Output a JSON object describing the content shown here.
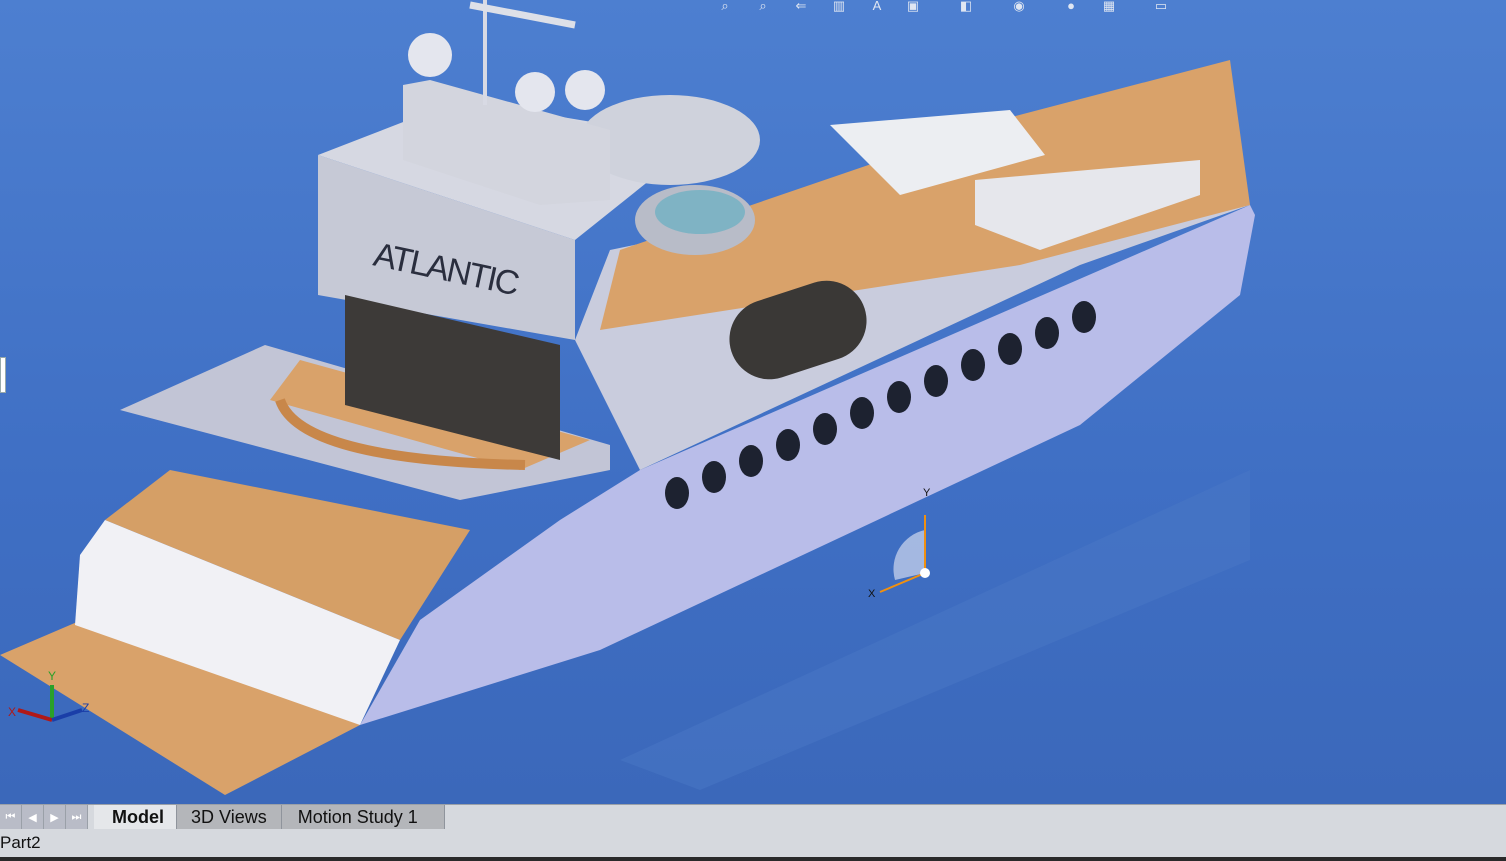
{
  "toolbar": {
    "icons": [
      "zoom-to-fit-icon",
      "zoom-to-area-icon",
      "previous-view-icon",
      "section-view-icon",
      "dynamic-annotation-icon",
      "view-orientation-icon",
      "display-style-icon",
      "hide-show-items-icon",
      "edit-appearance-icon",
      "apply-scene-icon",
      "view-settings-icon"
    ]
  },
  "model": {
    "name_lettering": "ATLANTIC",
    "triad": {
      "x": "X",
      "y": "Y",
      "z": "Z"
    },
    "origin": {
      "x": "X",
      "y": "Y"
    }
  },
  "colors": {
    "background": "#4576c8",
    "hull": "#b9bde9",
    "wood": "#d9a26a",
    "superstructure": "#c9ccd9"
  },
  "tabs": {
    "items": [
      "Model",
      "3D Views",
      "Motion Study 1"
    ],
    "active": "Model"
  },
  "status": {
    "document": "Part2"
  }
}
